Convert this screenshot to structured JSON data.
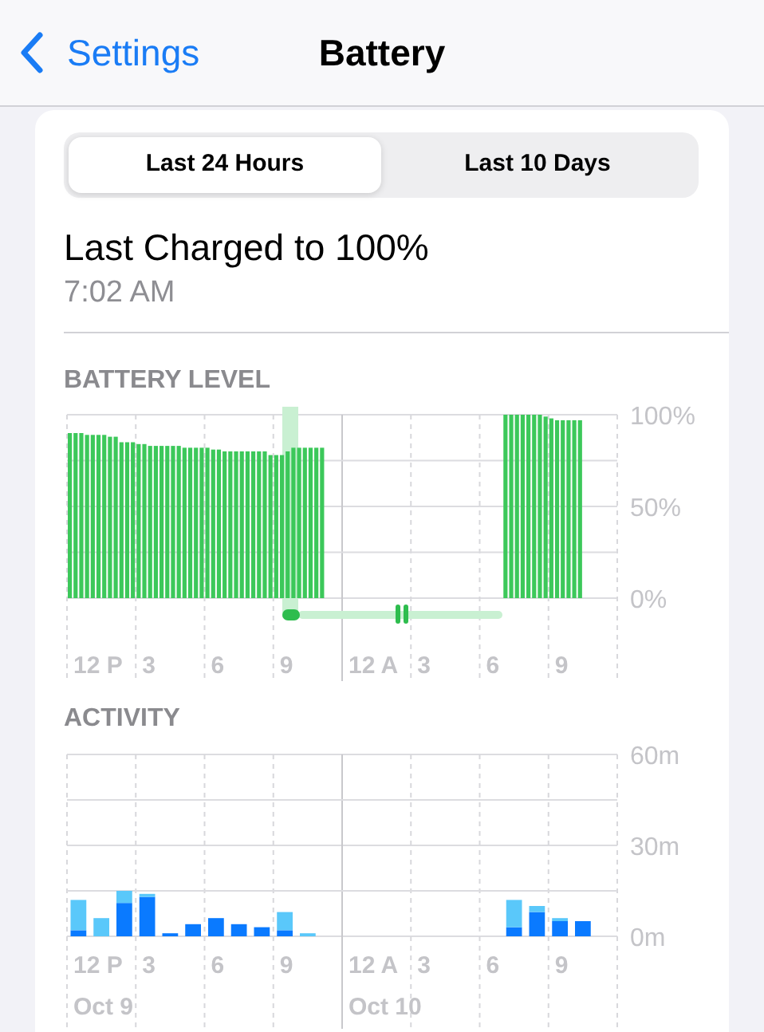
{
  "nav": {
    "back_label": "Settings",
    "title": "Battery"
  },
  "tabs": [
    {
      "label": "Last 24 Hours",
      "selected": true
    },
    {
      "label": "Last 10 Days",
      "selected": false
    }
  ],
  "last_charged": {
    "title": "Last Charged to 100%",
    "time": "7:02 AM"
  },
  "battery_level": {
    "heading": "BATTERY LEVEL",
    "axis_labels": [
      {
        "label": "12 P"
      },
      {
        "label": "3"
      },
      {
        "label": "6"
      },
      {
        "label": "9"
      },
      {
        "label": "12 A"
      },
      {
        "label": "3"
      },
      {
        "label": "6"
      },
      {
        "label": "9"
      }
    ],
    "chart_data": {
      "type": "bar",
      "ylim": [
        0,
        100
      ],
      "series": [
        {
          "color": "#3cc85a",
          "values": [
            90,
            90,
            90,
            89,
            89,
            89,
            89,
            88,
            88,
            85,
            85,
            85,
            84,
            84,
            83,
            83,
            83,
            83,
            83,
            83,
            82,
            82,
            82,
            82,
            82,
            81,
            81,
            80,
            80,
            80,
            80,
            80,
            80,
            80,
            80,
            78,
            78,
            78,
            80,
            82,
            82,
            82,
            82,
            82,
            82,
            null,
            null,
            null,
            null,
            null,
            null,
            null,
            null,
            null,
            null,
            null,
            null,
            null,
            null,
            null,
            null,
            null,
            null,
            null,
            null,
            null,
            null,
            null,
            null,
            null,
            null,
            null,
            null,
            null,
            null,
            null,
            100,
            100,
            100,
            100,
            100,
            100,
            100,
            99,
            98,
            97,
            97,
            97,
            97,
            97,
            null,
            null,
            null,
            null,
            null,
            null
          ]
        }
      ],
      "yticks": [
        {
          "value": 0,
          "label": "0%"
        },
        {
          "value": 50,
          "label": "50%"
        },
        {
          "value": 100,
          "label": "100%"
        }
      ]
    }
  },
  "activity": {
    "heading": "ACTIVITY",
    "axis_labels": [
      {
        "label": "12 P",
        "date": "Oct 9"
      },
      {
        "label": "3"
      },
      {
        "label": "6"
      },
      {
        "label": "9"
      },
      {
        "label": "12 A",
        "date": "Oct 10"
      },
      {
        "label": "3"
      },
      {
        "label": "6"
      },
      {
        "label": "9"
      }
    ],
    "chart_data": {
      "type": "bar",
      "stacked": true,
      "ylim": [
        0,
        60
      ],
      "series": [
        {
          "color": "#0a7aff",
          "values": [
            2,
            0,
            11,
            13,
            1,
            4,
            6,
            4,
            3,
            2,
            0,
            0,
            0,
            0,
            0,
            0,
            0,
            0,
            0,
            3,
            8,
            5,
            5,
            0
          ]
        },
        {
          "color": "#5ac8fa",
          "values": [
            10,
            6,
            4,
            1,
            0,
            0,
            0,
            0,
            0,
            6,
            1,
            0,
            0,
            0,
            0,
            0,
            0,
            0,
            0,
            9,
            2,
            1,
            0,
            0
          ]
        }
      ],
      "yticks": [
        {
          "value": 0,
          "label": "0m"
        },
        {
          "value": 30,
          "label": "30m"
        },
        {
          "value": 60,
          "label": "60m"
        }
      ]
    }
  }
}
